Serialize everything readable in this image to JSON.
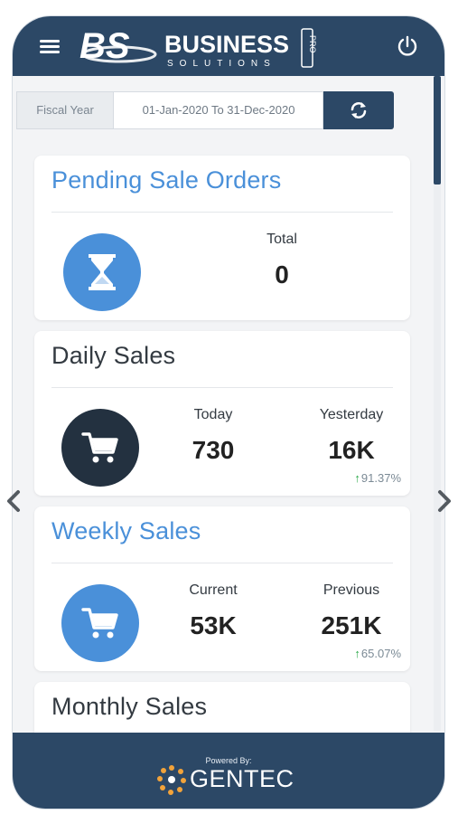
{
  "header": {
    "logo_mark": "BS",
    "logo_main": "BUSINESS",
    "logo_sub": "SOLUTIONS",
    "logo_tag": "PRO"
  },
  "filter": {
    "label": "Fiscal Year",
    "value": "01-Jan-2020 To 31-Dec-2020"
  },
  "cards": {
    "pending": {
      "title": "Pending Sale Orders",
      "label": "Total",
      "value": "0"
    },
    "daily": {
      "title": "Daily Sales",
      "today_label": "Today",
      "today_value": "730",
      "yesterday_label": "Yesterday",
      "yesterday_value": "16K",
      "delta": "91.37%"
    },
    "weekly": {
      "title": "Weekly Sales",
      "current_label": "Current",
      "current_value": "53K",
      "previous_label": "Previous",
      "previous_value": "251K",
      "delta": "65.07%"
    },
    "monthly": {
      "title": "Monthly Sales"
    }
  },
  "footer": {
    "powered_by": "Powered By:",
    "brand": "GENTEC"
  },
  "colors": {
    "navy": "#2c4866",
    "accent_blue": "#4a90d9",
    "dark_circle": "#233140",
    "delta_green": "#2daa4a"
  },
  "icons": [
    "menu-icon",
    "power-icon",
    "refresh-icon",
    "hourglass-icon",
    "cart-icon",
    "chevron-left-icon",
    "chevron-right-icon"
  ]
}
